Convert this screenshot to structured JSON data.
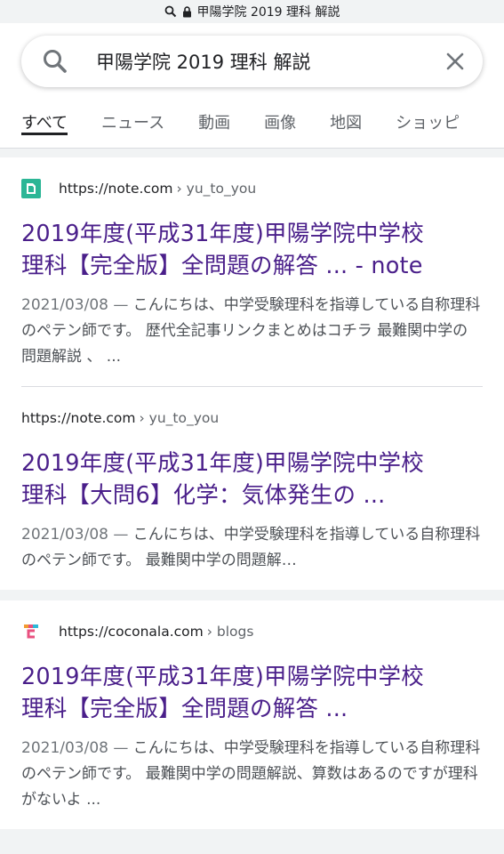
{
  "urlbar": {
    "text": "甲陽学院 2019 理科 解説"
  },
  "search": {
    "query": "甲陽学院 2019 理科 解説"
  },
  "tabs": [
    {
      "label": "すべて"
    },
    {
      "label": "ニュース"
    },
    {
      "label": "動画"
    },
    {
      "label": "画像"
    },
    {
      "label": "地図"
    },
    {
      "label": "ショッピ"
    }
  ],
  "results": [
    {
      "domain": "https://note.com",
      "path": "› yu_to_you",
      "title_line1": "2019年度(平成31年度)甲陽学院中学校",
      "title_line2": "理科【完全版】全問題の解答 ... - note",
      "date": "2021/03/08 —",
      "snippet": "こんにちは、中学受験理科を指導している自称理科のペテン師です。 歴代全記事リンクまとめはコチラ 最難関中学の問題解説 、 ..."
    },
    {
      "domain": "https://note.com",
      "path": "› yu_to_you",
      "title_line1": "2019年度(平成31年度)甲陽学院中学校",
      "title_line2": "理科【大問6】化学：気体発生の ...",
      "date": "2021/03/08 —",
      "snippet": "こんにちは、中学受験理科を指導している自称理科のペテン師です。 最難関中学の問題解…"
    },
    {
      "domain": "https://coconala.com",
      "path": "› blogs",
      "title_line1": "2019年度(平成31年度)甲陽学院中学校",
      "title_line2": "理科【完全版】全問題の解答 ...",
      "date": "2021/03/08 —",
      "snippet": "こんにちは、中学受験理科を指導している自称理科のペテン師です。 最難関中学の問題解説、算数はあるのですが理科がないよ ..."
    }
  ],
  "icons": {
    "urlbar_search": "search-icon",
    "urlbar_lock": "lock-icon",
    "searchbox_search": "search-icon",
    "clear": "close-icon",
    "note_favicon": "note-favicon-icon",
    "coconala_favicon": "coconala-favicon-icon"
  },
  "colors": {
    "title": "#4a1f8a",
    "note_favicon": "#2cb696"
  }
}
